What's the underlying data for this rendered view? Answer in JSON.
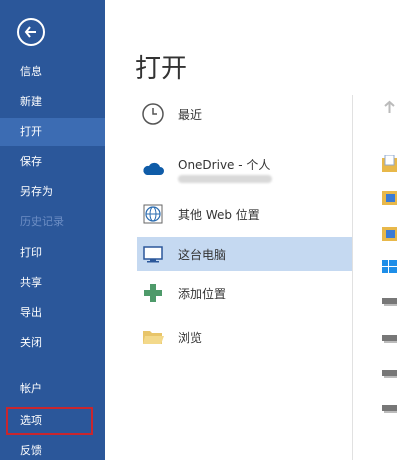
{
  "sidebar": {
    "items": [
      {
        "label": "信息"
      },
      {
        "label": "新建"
      },
      {
        "label": "打开"
      },
      {
        "label": "保存"
      },
      {
        "label": "另存为"
      },
      {
        "label": "历史记录"
      },
      {
        "label": "打印"
      },
      {
        "label": "共享"
      },
      {
        "label": "导出"
      },
      {
        "label": "关闭"
      },
      {
        "label": "帐户"
      },
      {
        "label": "选项"
      },
      {
        "label": "反馈"
      }
    ]
  },
  "main": {
    "title": "打开",
    "locations": [
      {
        "label": "最近",
        "icon": "clock-icon"
      },
      {
        "label": "OneDrive - 个人",
        "icon": "cloud-icon"
      },
      {
        "label": "其他 Web 位置",
        "icon": "web-globe-icon"
      },
      {
        "label": "这台电脑",
        "icon": "computer-icon"
      },
      {
        "label": "添加位置",
        "icon": "plus-icon"
      },
      {
        "label": "浏览",
        "icon": "folder-open-icon"
      }
    ]
  },
  "colors": {
    "sidebar_bg": "#2b579a",
    "active_item": "#3c6cb3",
    "selected_location": "#c5d9f1",
    "highlight_border": "#c9262d"
  }
}
